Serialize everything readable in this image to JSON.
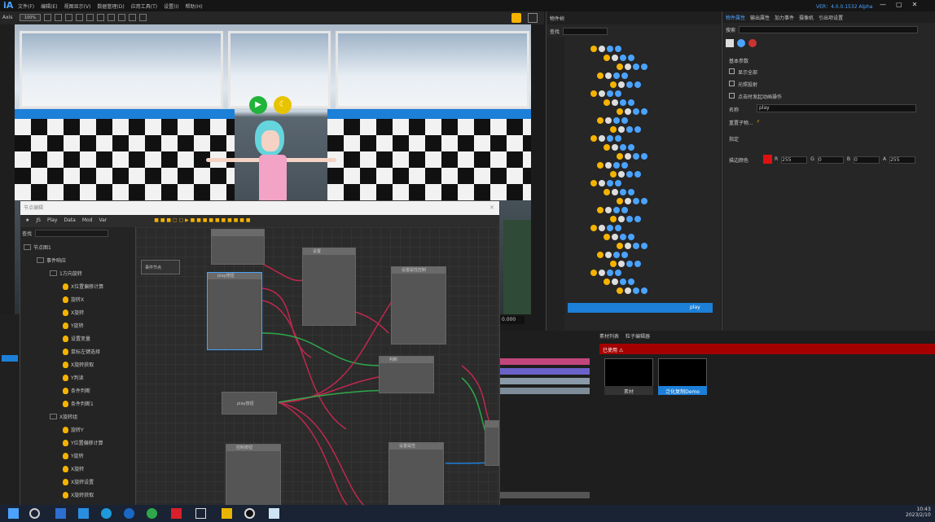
{
  "app": {
    "logo": "iA",
    "version": "VER：4.0.0.1532 Alpha",
    "menu": [
      "文件(F)",
      "编辑(E)",
      "视图显示(V)",
      "数据管理(D)",
      "应用工具(T)",
      "设置(I)",
      "帮助(H)"
    ]
  },
  "toolbar": {
    "left_label": "Axis",
    "zoom_value": "100%"
  },
  "node_editor": {
    "title": "节点编辑",
    "tabs": [
      "JS",
      "Play",
      "Data",
      "Mod",
      "Var"
    ],
    "search_label": "查找",
    "tree": [
      {
        "label": "节点图1",
        "indent": 0
      },
      {
        "label": "事件响应",
        "indent": 1
      },
      {
        "label": "1方向旋转",
        "indent": 2
      },
      {
        "label": "X位置偏移计算",
        "indent": 3
      },
      {
        "label": "旋转X",
        "indent": 3
      },
      {
        "label": "X旋转",
        "indent": 3
      },
      {
        "label": "Y旋转",
        "indent": 3
      },
      {
        "label": "设置变量",
        "indent": 3
      },
      {
        "label": "鼠标左键选择",
        "indent": 3
      },
      {
        "label": "X旋转获取",
        "indent": 3
      },
      {
        "label": "Y判读",
        "indent": 3
      },
      {
        "label": "条件判断",
        "indent": 3
      },
      {
        "label": "条件判断1",
        "indent": 3
      },
      {
        "label": "X旋转组",
        "indent": 2
      },
      {
        "label": "旋转Y",
        "indent": 3
      },
      {
        "label": "Y位置偏移计算",
        "indent": 3
      },
      {
        "label": "Y旋转",
        "indent": 3
      },
      {
        "label": "X旋转",
        "indent": 3
      },
      {
        "label": "X旋转设置",
        "indent": 3
      },
      {
        "label": "X旋转获取",
        "indent": 3
      }
    ],
    "graph_nodes": [
      {
        "title": "事件节点"
      },
      {
        "title": "play按钮"
      },
      {
        "title": "设置"
      },
      {
        "title": "设置属性控制"
      },
      {
        "title": "判断"
      },
      {
        "title": "play按钮"
      },
      {
        "title": "控制按钮"
      },
      {
        "title": "设置属性"
      }
    ]
  },
  "object_panel": {
    "title": "物件树",
    "search_label": "查找",
    "selected_label": "play"
  },
  "property_panel": {
    "tabs": [
      "物件属性",
      "输出属性",
      "加力事件",
      "摄像机",
      "引出项设置"
    ],
    "search_label": "搜索",
    "sections": {
      "basic": "基本参数",
      "lighting": "指定"
    },
    "options": [
      "显示全部",
      "光照投射",
      "点击时发起动画操作"
    ],
    "fields": {
      "name_label": "名称",
      "name_value": "play",
      "owner_label": "重置子物...",
      "color_label": "描边颜色",
      "r": "255",
      "g": "0",
      "b": "0",
      "a": "255"
    }
  },
  "material": {
    "tabs": [
      "素材列表",
      "粒子编辑器"
    ],
    "header": "已使用",
    "items": [
      "素材",
      "泛化复制Demo"
    ]
  },
  "status": {
    "coord": "0.000",
    "time": "10:43",
    "date": "2023/2/10"
  },
  "colors": {
    "accent": "#1c7fd8",
    "alert": "#a50000",
    "play": "#21b33a",
    "mood": "#e8c400"
  }
}
